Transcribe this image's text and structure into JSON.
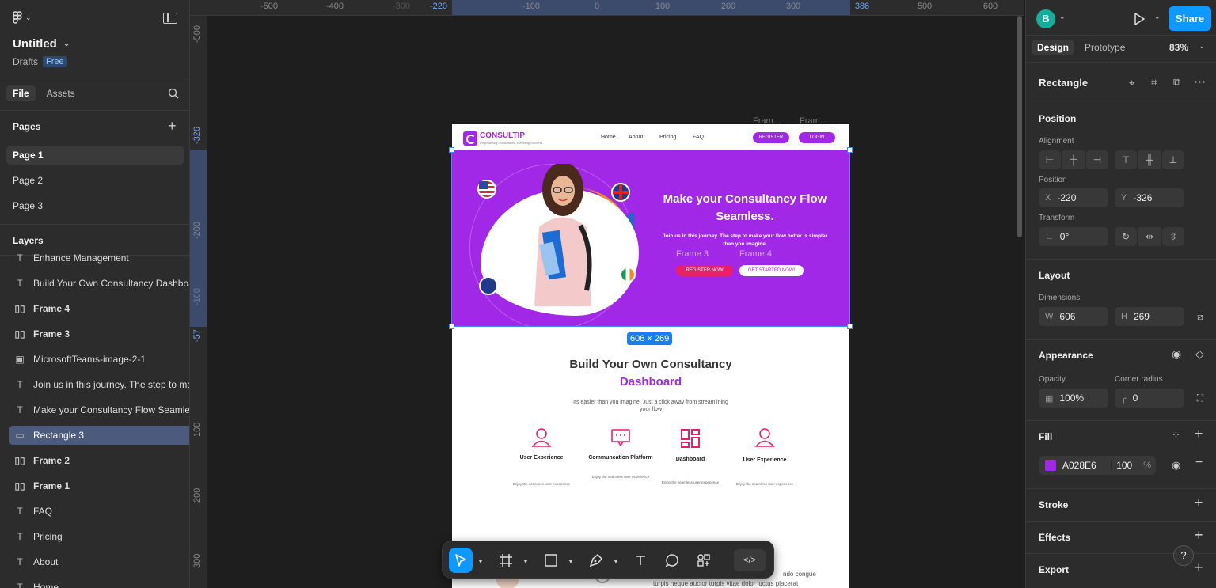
{
  "left": {
    "file_name": "Untitled",
    "location": "Drafts",
    "plan_badge": "Free",
    "tabs": [
      "File",
      "Assets"
    ],
    "pages_heading": "Pages",
    "pages": [
      "Page 1",
      "Page 2",
      "Page 3"
    ],
    "layers_heading": "Layers",
    "layers": [
      {
        "name": "Enhance Management",
        "icon": "text-icon",
        "glyph": "T"
      },
      {
        "name": "Build Your Own Consultancy Dashboard",
        "icon": "text-icon",
        "glyph": "T"
      },
      {
        "name": "Frame 4",
        "icon": "auto-layout-frame-icon",
        "glyph": "▯▯"
      },
      {
        "name": "Frame 3",
        "icon": "auto-layout-frame-icon",
        "glyph": "▯▯"
      },
      {
        "name": "MicrosoftTeams-image-2-1",
        "icon": "image-icon",
        "glyph": "▣"
      },
      {
        "name": "Join us in this journey. The step to make",
        "icon": "text-icon",
        "glyph": "T"
      },
      {
        "name": "Make your Consultancy Flow Seamless",
        "icon": "text-icon",
        "glyph": "T"
      },
      {
        "name": "Rectangle 3",
        "icon": "rectangle-icon",
        "glyph": "▭"
      },
      {
        "name": "Frame 2",
        "icon": "auto-layout-frame-icon",
        "glyph": "▯▯"
      },
      {
        "name": "Frame 1",
        "icon": "auto-layout-frame-icon",
        "glyph": "▯▯"
      },
      {
        "name": "FAQ",
        "icon": "text-icon",
        "glyph": "T"
      },
      {
        "name": "Pricing",
        "icon": "text-icon",
        "glyph": "T"
      },
      {
        "name": "About",
        "icon": "text-icon",
        "glyph": "T"
      },
      {
        "name": "Home",
        "icon": "text-icon",
        "glyph": "T"
      }
    ]
  },
  "rulers": {
    "top": [
      "-500",
      "-400",
      "-300",
      "-220",
      "-100",
      "0",
      "100",
      "200",
      "300",
      "386",
      "500",
      "600"
    ],
    "left": [
      "-500",
      "-326",
      "-200",
      "-100",
      "-57",
      "100",
      "200",
      "300"
    ]
  },
  "canvas": {
    "frame_tags": [
      "Fram...",
      "Fram..."
    ],
    "selection_size": "606 × 269",
    "site": {
      "brand": "CONSULTIP",
      "tagline": "Empowering Consultants, Elevating Success",
      "nav": [
        "Home",
        "About",
        "Pricing",
        "FAQ"
      ],
      "register": "REGISTER",
      "login": "LOGIN",
      "hero_title": "Make your Consultancy Flow Seamless.",
      "hero_sub": "Join us in this journey. The step to make your flow better is simpler than you imagine.",
      "frame3_label": "Frame 3",
      "frame4_label": "Frame 4",
      "register_now": "REGISTER NOW",
      "get_started": "GET STARTED NOW!",
      "section_title_1": "Build Your Own Consultancy",
      "section_title_2": "Dashboard",
      "section_sub": "Its easier than you imagine, Just a click away from streamlining your flow",
      "features": [
        {
          "title": "User Experience",
          "desc": "Enjoy the seamless user experience"
        },
        {
          "title": "Communcation Platform",
          "desc": "Enjoy the seamless user experience"
        },
        {
          "title": "Dashboard",
          "desc": "Enjoy the seamless user experience"
        },
        {
          "title": "User Experience",
          "desc": "Enjoy the seamless user experience"
        }
      ],
      "footer_text_1": "ndo congue",
      "footer_text_2": "turpis neque auctor turpis vitae dolor luctus placerat"
    }
  },
  "right": {
    "avatar_initial": "B",
    "share": "Share",
    "tabs": [
      "Design",
      "Prototype"
    ],
    "zoom": "83%",
    "layer_type": "Rectangle",
    "position_heading": "Position",
    "alignment_label": "Alignment",
    "position_label": "Position",
    "x_key": "X",
    "x_val": "-220",
    "y_key": "Y",
    "y_val": "-326",
    "transform_label": "Transform",
    "rotation": "0°",
    "layout_heading": "Layout",
    "dimensions_label": "Dimensions",
    "w_key": "W",
    "w_val": "606",
    "h_key": "H",
    "h_val": "269",
    "appearance_heading": "Appearance",
    "opacity_label": "Opacity",
    "opacity_val": "100%",
    "radius_label": "Corner radius",
    "radius_val": "0",
    "fill_heading": "Fill",
    "fill_hex": "A028E6",
    "fill_opacity": "100",
    "fill_pct": "%",
    "stroke_heading": "Stroke",
    "effects_heading": "Effects",
    "export_heading": "Export",
    "help": "?"
  },
  "colors": {
    "accent": "#0d99ff",
    "fill": "#A028E6",
    "pink": "#e8206a"
  }
}
